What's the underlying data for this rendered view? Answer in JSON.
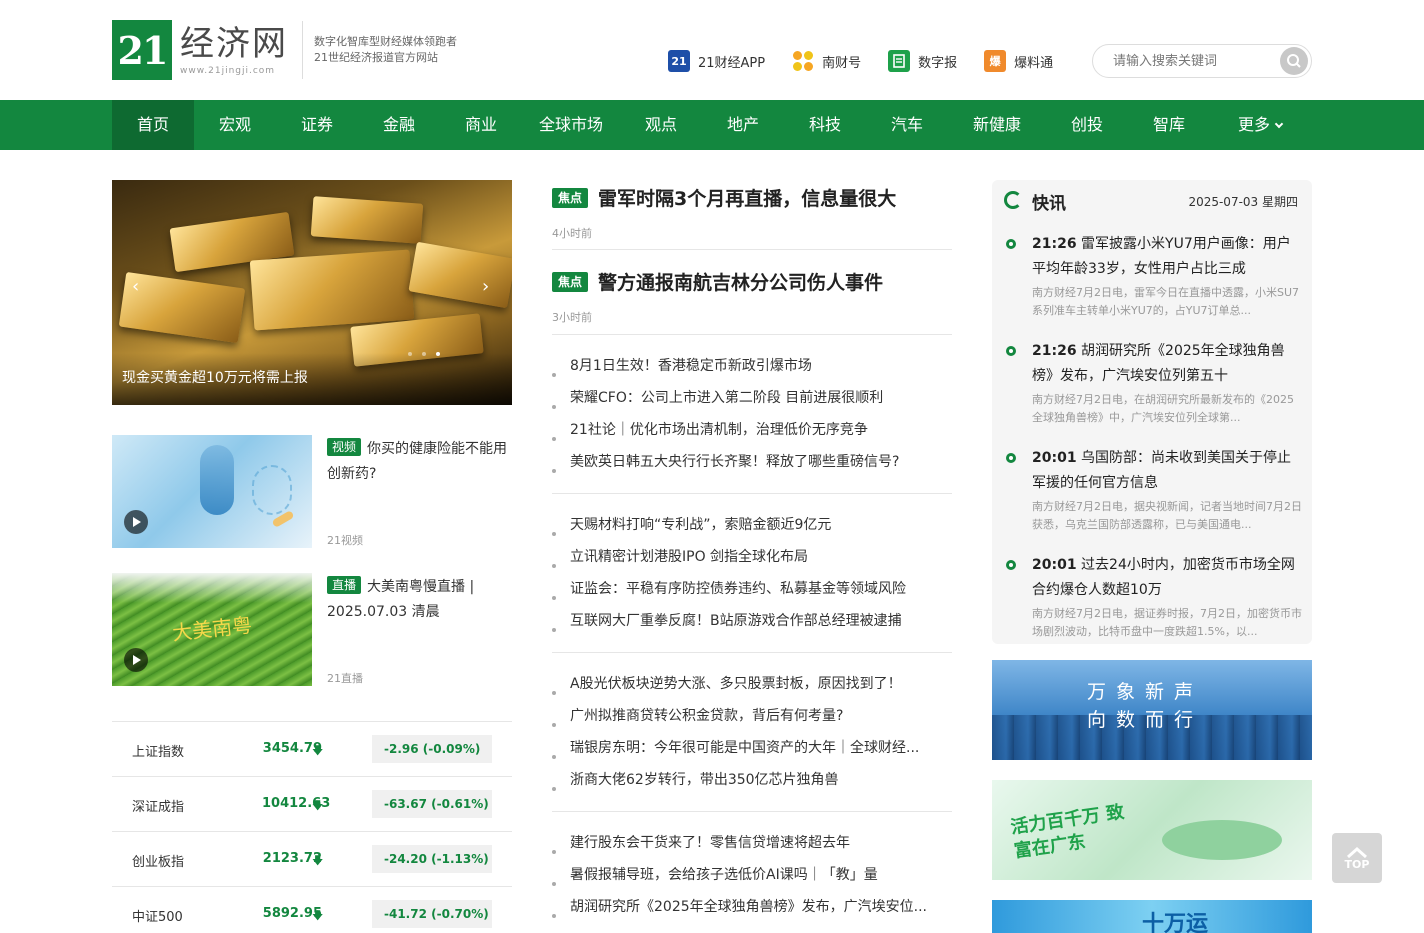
{
  "header": {
    "logo_number": "21",
    "logo_name": "经济网",
    "logo_url": "www.21jingji.com",
    "slogan_line1": "数字化智库型财经媒体领跑者",
    "slogan_line2": "21世纪经济报道官方网站",
    "links": [
      {
        "label": "21财经APP",
        "icon": "21-app-icon"
      },
      {
        "label": "南财号",
        "icon": "nancai-icon"
      },
      {
        "label": "数字报",
        "icon": "digital-paper-icon"
      },
      {
        "label": "爆料通",
        "icon": "tipoff-icon"
      }
    ],
    "search_placeholder": "请输入搜索关键词"
  },
  "nav": {
    "items": [
      "首页",
      "宏观",
      "证券",
      "金融",
      "商业",
      "全球市场",
      "观点",
      "地产",
      "科技",
      "汽车",
      "新健康",
      "创投",
      "智库",
      "更多"
    ],
    "active": "首页"
  },
  "banner": {
    "caption": "现金买黄金超10万元将需上报",
    "prev": "‹",
    "next": "›"
  },
  "media_cards": [
    {
      "tag": "视频",
      "title": "你买的健康险能不能用创新药?",
      "source": "21视频"
    },
    {
      "tag": "直播",
      "title": "大美南粤慢直播 | 2025.07.03 清晨",
      "source": "21直播"
    }
  ],
  "stocks": [
    {
      "name": "上证指数",
      "value": "3454.79",
      "change": "-2.96",
      "pct": "(-0.09%)"
    },
    {
      "name": "深证成指",
      "value": "10412.63",
      "change": "-63.67",
      "pct": "(-0.61%)"
    },
    {
      "name": "创业板指",
      "value": "2123.72",
      "change": "-24.20",
      "pct": "(-1.13%)"
    },
    {
      "name": "中证500",
      "value": "5892.95",
      "change": "-41.72",
      "pct": "(-0.70%)"
    }
  ],
  "focus": [
    {
      "tag": "焦点",
      "title": "雷军时隔3个月再直播，信息量很大",
      "time": "4小时前"
    },
    {
      "tag": "焦点",
      "title": "警方通报南航吉林分公司伤人事件",
      "time": "3小时前"
    }
  ],
  "news_groups": [
    [
      "8月1日生效！香港稳定币新政引爆市场",
      "荣耀CFO：公司上市进入第二阶段 目前进展很顺利",
      "21社论｜优化市场出清机制，治理低价无序竞争",
      "美欧英日韩五大央行行长齐聚！释放了哪些重磅信号?"
    ],
    [
      "天赐材料打响“专利战”，索赔金额近9亿元",
      "立讯精密计划港股IPO 剑指全球化布局",
      "证监会：平稳有序防控债券违约、私募基金等领域风险",
      "互联网大厂重拳反腐！B站原游戏合作部总经理被逮捕"
    ],
    [
      "A股光伏板块逆势大涨、多只股票封板，原因找到了！",
      "广州拟推商贷转公积金贷款，背后有何考量?",
      "瑞银房东明：今年很可能是中国资产的大年｜全球财经...",
      "浙商大佬62岁转行，带出350亿芯片独角兽"
    ],
    [
      "建行股东会干货来了！零售信贷增速将超去年",
      "暑假报辅导班，会给孩子选低价AI课吗｜「教」量",
      "胡润研究所《2025年全球独角兽榜》发布，广汽埃安位..."
    ]
  ],
  "flash": {
    "title": "快讯",
    "date": "2025-07-03 星期四",
    "items": [
      {
        "time": "21:26",
        "title": "雷军披露小米YU7用户画像：用户平均年龄33岁，女性用户占比三成",
        "desc": "南方财经7月2日电，雷军今日在直播中透露，小米SU7 系列准车主转单小米YU7的，占YU7订单总..."
      },
      {
        "time": "21:26",
        "title": "胡润研究所《2025年全球独角兽榜》发布，广汽埃安位列第五十",
        "desc": "南方财经7月2日电，在胡润研究所最新发布的《2025全球独角兽榜》中，广汽埃安位列全球第..."
      },
      {
        "time": "20:01",
        "title": "乌国防部：尚未收到美国关于停止军援的任何官方信息",
        "desc": "南方财经7月2日电，据央视新闻，记者当地时间7月2日获悉，乌克兰国防部透露称，已与美国通电..."
      },
      {
        "time": "20:01",
        "title": "过去24小时内，加密货币市场全网合约爆仓人数超10万",
        "desc": "南方财经7月2日电，据证券时报，7月2日，加密货币市场剧烈波动，比特币盘中一度跌超1.5%，以..."
      }
    ]
  },
  "ads": [
    {
      "text": "万象新声 向数而行"
    },
    {
      "text": "活力百千万 致富在广东"
    },
    {
      "text": "十万运"
    }
  ],
  "top_button": "TOP"
}
